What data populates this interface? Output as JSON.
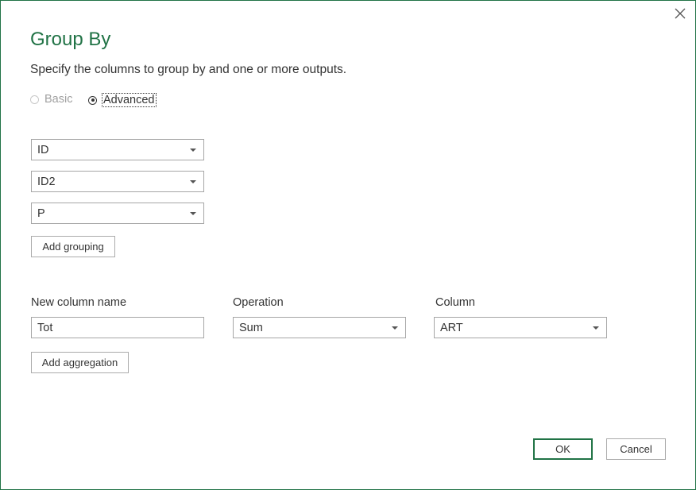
{
  "dialog": {
    "title": "Group By",
    "subtitle": "Specify the columns to group by and one or more outputs.",
    "mode": {
      "basic_label": "Basic",
      "advanced_label": "Advanced",
      "selected": "Advanced"
    },
    "grouping_columns": [
      "ID",
      "ID2",
      "P"
    ],
    "add_grouping_label": "Add grouping",
    "aggregation": {
      "headers": {
        "new_column_name": "New column name",
        "operation": "Operation",
        "column": "Column"
      },
      "rows": [
        {
          "new_column_name": "Tot",
          "operation": "Sum",
          "column": "ART"
        }
      ]
    },
    "add_aggregation_label": "Add aggregation",
    "ok_label": "OK",
    "cancel_label": "Cancel",
    "accent_color": "#217346",
    "close_icon": "close-icon"
  }
}
